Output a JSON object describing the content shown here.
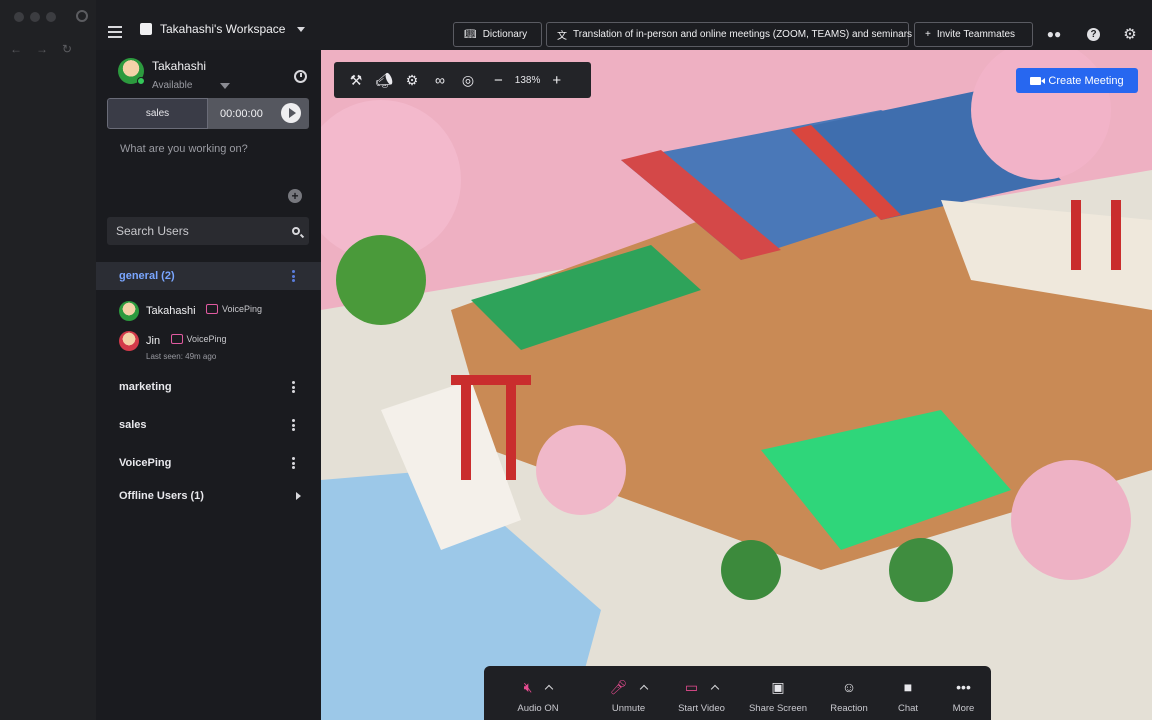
{
  "workspace": {
    "name": "Takahashi's Workspace"
  },
  "topbar": {
    "dictionary_label": "Dictionary",
    "translation_label": "Translation of in-person and online meetings (ZOOM, TEAMS) and seminars",
    "invite_label": "Invite Teammates"
  },
  "user": {
    "name": "Takahashi",
    "status": "Available"
  },
  "timer": {
    "project": "sales",
    "time": "00:00:00"
  },
  "working_placeholder": "What are you working on?",
  "search": {
    "placeholder": "Search Users"
  },
  "groups": [
    {
      "label": "general (2)"
    },
    {
      "label": "marketing"
    },
    {
      "label": "sales"
    },
    {
      "label": "VoicePing"
    }
  ],
  "members": [
    {
      "name": "Takahashi",
      "tag": "VoicePing",
      "seen": ""
    },
    {
      "name": "Jin",
      "tag": "VoicePing",
      "seen": "Last seen: 49m ago"
    }
  ],
  "offline_label": "Offline Users (1)",
  "map": {
    "zoom": "138%",
    "create_meeting_label": "Create Meeting"
  },
  "controls": [
    {
      "label": "Audio ON",
      "icon": "speaker-muted-icon"
    },
    {
      "label": "Unmute",
      "icon": "mic-muted-icon"
    },
    {
      "label": "Start Video",
      "icon": "video-off-icon"
    },
    {
      "label": "Share Screen",
      "icon": "share-screen-icon"
    },
    {
      "label": "Reaction",
      "icon": "emoji-icon"
    },
    {
      "label": "Chat",
      "icon": "chat-icon"
    },
    {
      "label": "More",
      "icon": "more-icon"
    }
  ],
  "colors": {
    "accent": "#2767f0",
    "active_group": "#7aa6ff",
    "muted": "#e54b8f",
    "online": "#34c759"
  }
}
